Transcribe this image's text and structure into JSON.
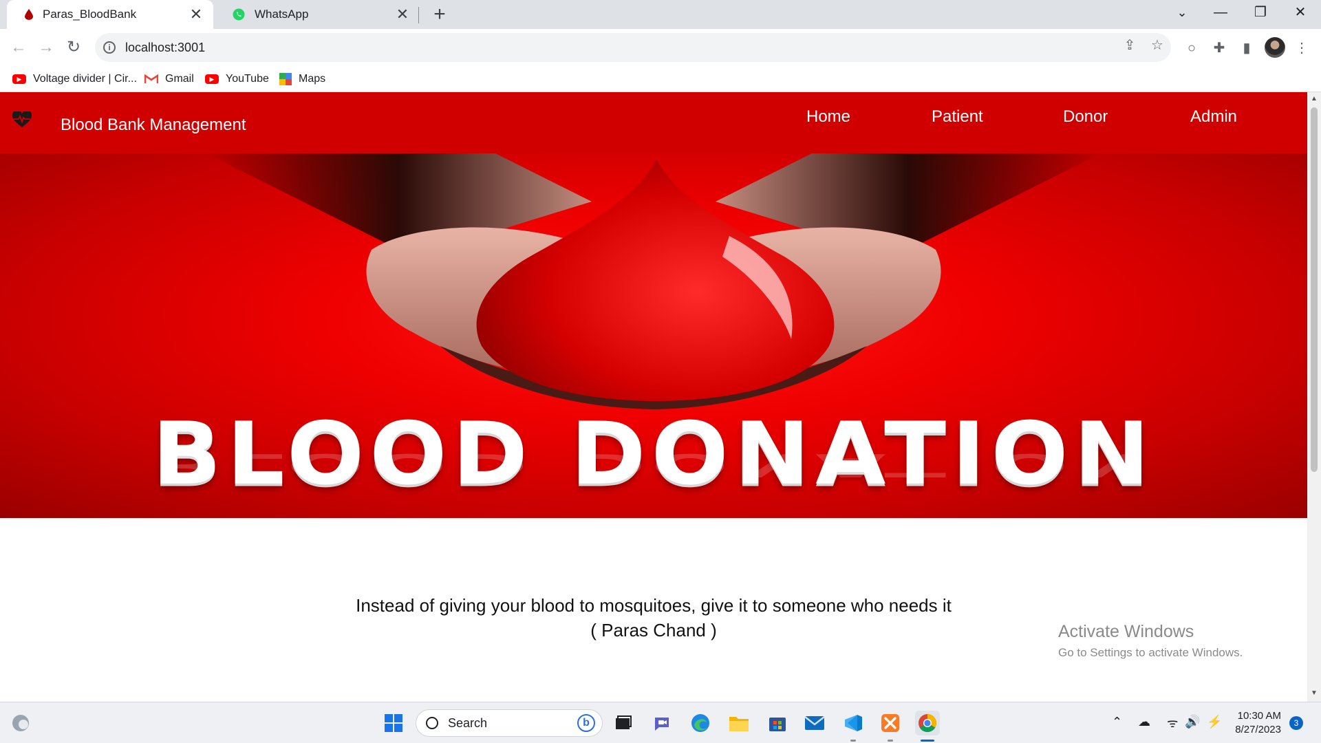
{
  "browser": {
    "tabs": [
      {
        "title": "Paras_BloodBank",
        "active": true
      },
      {
        "title": "WhatsApp",
        "active": false
      }
    ],
    "tab_close": "✕",
    "new_tab": "+",
    "window_controls": {
      "dropdown": "⌄",
      "minimize": "—",
      "restore": "❐",
      "close": "✕"
    },
    "url": "localhost:3001",
    "bookmarks": [
      {
        "label": "Voltage divider | Cir...",
        "icon": "youtube-icon"
      },
      {
        "label": "Gmail",
        "icon": "gmail-icon"
      },
      {
        "label": "YouTube",
        "icon": "youtube-icon"
      },
      {
        "label": "Maps",
        "icon": "maps-icon"
      }
    ]
  },
  "site": {
    "brand": "Blood Bank Management",
    "nav": [
      "Home",
      "Patient",
      "Donor",
      "Admin"
    ],
    "hero_text": "BLOOD DONATION",
    "quote_line1": "Instead of giving your blood to mosquitoes, give it to someone who needs it",
    "quote_line2": "( Paras Chand )",
    "theme_color": "#d10000"
  },
  "watermark": {
    "title": "Activate Windows",
    "subtitle": "Go to Settings to activate Windows."
  },
  "taskbar": {
    "search_label": "Search",
    "time": "10:30 AM",
    "date": "8/27/2023",
    "notification_count": "3"
  }
}
